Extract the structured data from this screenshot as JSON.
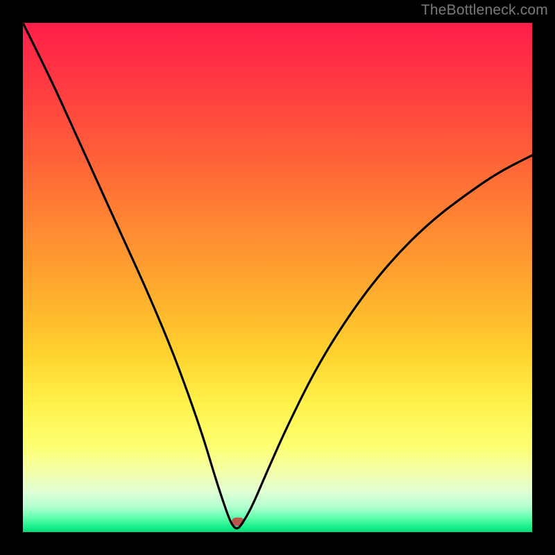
{
  "watermark": "TheBottleneck.com",
  "chart_data": {
    "type": "line",
    "title": "",
    "xlabel": "",
    "ylabel": "",
    "xlim": [
      0,
      100
    ],
    "ylim": [
      0,
      100
    ],
    "grid": false,
    "legend": false,
    "series": [
      {
        "name": "bottleneck-curve",
        "x": [
          0,
          5,
          10,
          15,
          20,
          25,
          30,
          35,
          38,
          40,
          41,
          42,
          43,
          45,
          48,
          52,
          58,
          65,
          72,
          80,
          88,
          94,
          100
        ],
        "y": [
          100,
          90,
          79,
          68,
          57,
          46,
          34,
          20,
          10,
          4,
          1.5,
          0.5,
          1.5,
          5,
          12,
          21,
          33,
          44,
          53,
          61,
          67,
          71,
          74
        ]
      }
    ],
    "marker": {
      "x": 42.3,
      "y": 2,
      "color": "#bb564f"
    },
    "gradient_stops": [
      {
        "pct": 0,
        "color": "#ff1e4a"
      },
      {
        "pct": 50,
        "color": "#ffb62d"
      },
      {
        "pct": 80,
        "color": "#fdff70"
      },
      {
        "pct": 100,
        "color": "#06da7a"
      }
    ]
  }
}
